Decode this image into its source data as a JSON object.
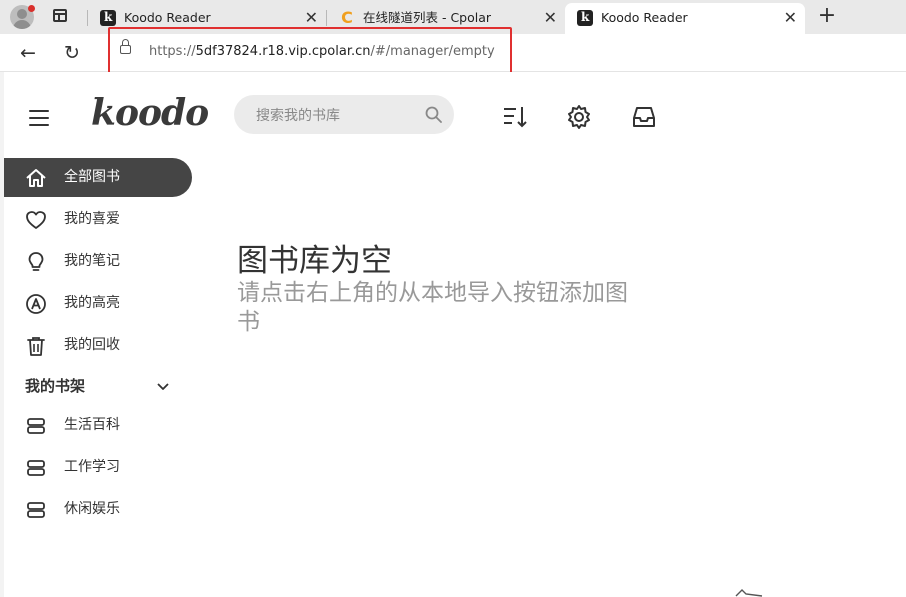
{
  "browser": {
    "tabs": [
      {
        "title": "Koodo Reader",
        "favicon": "koodo-icon",
        "active": false
      },
      {
        "title": "在线隧道列表 - Cpolar",
        "favicon": "cpolar-icon",
        "active": false
      },
      {
        "title": "Koodo Reader",
        "favicon": "koodo-icon",
        "active": true
      }
    ],
    "url_prefix": "https://",
    "url_host": "5df37824.r18.vip.cpolar.cn",
    "url_path": "/#/manager/empty",
    "close_glyph": "✕",
    "new_tab_glyph": "+",
    "back_glyph": "←",
    "reload_glyph": "↻",
    "highlight_color": "#e03030"
  },
  "app": {
    "logo": "koodo",
    "search_placeholder": "搜索我的书库",
    "sidebar": {
      "items": [
        {
          "label": "全部图书",
          "icon": "home-icon",
          "active": true
        },
        {
          "label": "我的喜爱",
          "icon": "heart-icon",
          "active": false
        },
        {
          "label": "我的笔记",
          "icon": "lightbulb-icon",
          "active": false
        },
        {
          "label": "我的高亮",
          "icon": "highlight-icon",
          "active": false
        },
        {
          "label": "我的回收",
          "icon": "trash-icon",
          "active": false
        }
      ],
      "shelf_title": "我的书架",
      "shelves": [
        {
          "label": "生活百科",
          "icon": "shelf-icon"
        },
        {
          "label": "工作学习",
          "icon": "shelf-icon"
        },
        {
          "label": "休闲娱乐",
          "icon": "shelf-icon"
        }
      ]
    },
    "empty": {
      "title": "图书库为空",
      "subtitle": "请点击右上角的从本地导入按钮添加图书"
    },
    "accent_color": "#454545"
  }
}
